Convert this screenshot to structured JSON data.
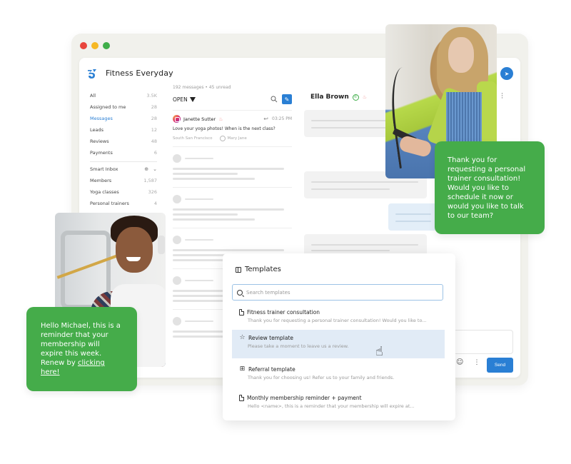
{
  "window": {
    "controls": [
      "close",
      "minimize",
      "maximize"
    ]
  },
  "app": {
    "title": "Fitness Everyday",
    "logo_icon": "brand-logo-icon"
  },
  "sidebar": {
    "items": [
      {
        "label": "All",
        "count": "3.5K",
        "active": false
      },
      {
        "label": "Assigned to me",
        "count": "28",
        "active": false
      },
      {
        "label": "Messages",
        "count": "28",
        "active": true
      },
      {
        "label": "Leads",
        "count": "12",
        "active": false
      },
      {
        "label": "Reviews",
        "count": "48",
        "active": false
      },
      {
        "label": "Payments",
        "count": "6",
        "active": false
      }
    ],
    "smart_inbox": {
      "label": "Smart Inbox",
      "items": [
        {
          "label": "Members",
          "count": "1,587"
        },
        {
          "label": "Yoga classes",
          "count": "326"
        },
        {
          "label": "Personal trainers",
          "count": "4"
        }
      ]
    }
  },
  "message_list": {
    "meta": "192 messages • 45 unread",
    "filter": "OPEN",
    "first_message": {
      "sender": "Janette Sutter",
      "channel_icon": "instagram-icon",
      "time": "03:25 PM",
      "text": "Love your yoga photos! When is the next class?",
      "location": "South San Francisco",
      "assignee": "Mary Jane"
    },
    "placeholder_count": 5
  },
  "conversation": {
    "contact_name": "Ella Brown",
    "send_label": "Send"
  },
  "overlays": {
    "right_message": "Thank you for requesting a personal trainer consultation! Would you like to schedule it now or would you like to talk to our team?",
    "left_message_prefix": "Hello Michael, this is a reminder that your membership will expire this week. Renew by ",
    "left_message_link": "clicking here!"
  },
  "templates": {
    "title": "Templates",
    "search_placeholder": "Search templates",
    "items": [
      {
        "icon": "document-icon",
        "name": "Fitness trainer consultation",
        "desc": "Thank you for requesting a personal trainer consultation! Would you like to...",
        "hover": false
      },
      {
        "icon": "star-icon",
        "name": "Review template",
        "desc": "Please take a moment to leave us a review.",
        "hover": true
      },
      {
        "icon": "gift-icon",
        "name": "Referral template",
        "desc": "Thank you for choosing us! Refer us to your family and friends.",
        "hover": false
      },
      {
        "icon": "document-icon",
        "name": "Monthly membership reminder + payment",
        "desc": "Hello <name>, this is a reminder that your membership will expire at...",
        "hover": false
      }
    ]
  },
  "colors": {
    "accent_blue": "#2a7fd4",
    "green_card": "#45ac4a",
    "hover_row": "#e1ebf6"
  }
}
